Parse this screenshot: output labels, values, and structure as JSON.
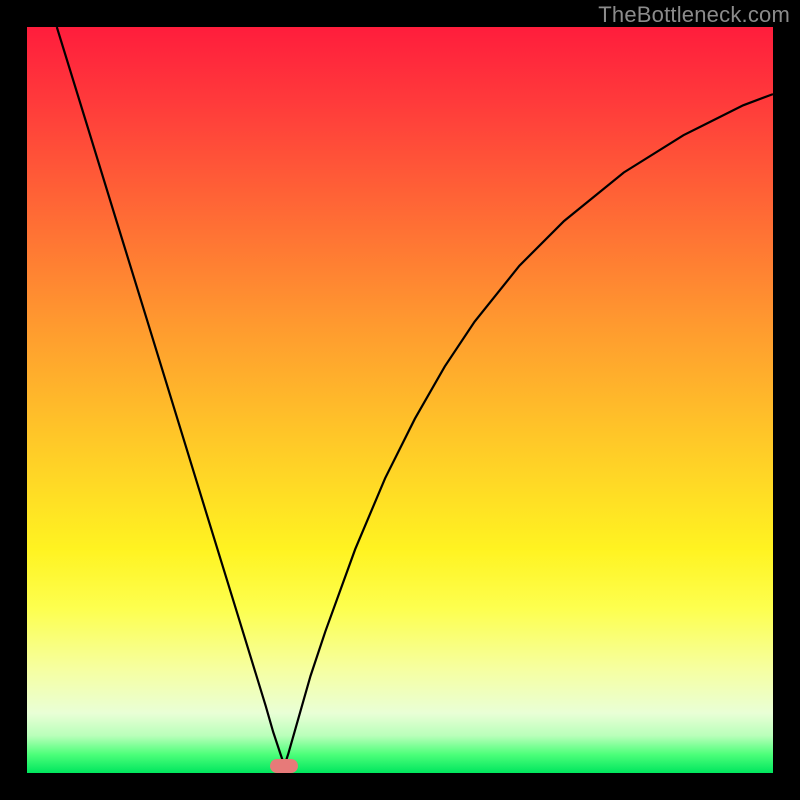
{
  "watermark": "TheBottleneck.com",
  "marker": {
    "x_pct": 34.5,
    "y_pct": 99
  },
  "chart_data": {
    "type": "line",
    "title": "",
    "xlabel": "",
    "ylabel": "",
    "xlim": [
      0,
      100
    ],
    "ylim": [
      0,
      100
    ],
    "grid": false,
    "legend": false,
    "series": [
      {
        "name": "curve",
        "x": [
          4,
          8,
          12,
          16,
          20,
          24,
          28,
          30,
          32,
          33,
          34,
          34.5,
          35,
          36,
          38,
          40,
          44,
          48,
          52,
          56,
          60,
          66,
          72,
          80,
          88,
          96,
          100
        ],
        "y": [
          100,
          87,
          74,
          61,
          48,
          35,
          22,
          15.5,
          9,
          5.5,
          2.5,
          1,
          2.5,
          6,
          13,
          19,
          30,
          39.5,
          47.5,
          54.5,
          60.5,
          68,
          74,
          80.5,
          85.5,
          89.5,
          91
        ]
      }
    ],
    "annotations": [
      {
        "type": "marker",
        "shape": "lozenge",
        "color": "#e77a79",
        "x": 34.5,
        "y": 1
      }
    ],
    "background": {
      "type": "vertical-gradient",
      "stops": [
        {
          "pct": 0,
          "color": "#ff1d3c"
        },
        {
          "pct": 50,
          "color": "#ffc728"
        },
        {
          "pct": 78,
          "color": "#fdff4f"
        },
        {
          "pct": 100,
          "color": "#00e65e"
        }
      ]
    }
  }
}
